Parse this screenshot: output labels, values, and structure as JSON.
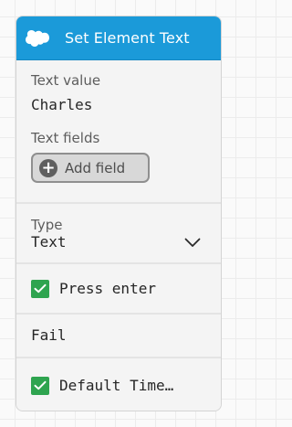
{
  "node": {
    "title": "Set Element Text",
    "logo_icon": "salesforce-cloud-icon",
    "accent_color": "#1b9ad9"
  },
  "text_value": {
    "label": "Text value",
    "value": "Charles"
  },
  "text_fields": {
    "label": "Text fields",
    "add_button_label": "Add field",
    "add_icon": "plus-circle-icon"
  },
  "type": {
    "label": "Type",
    "selected": "Text",
    "dropdown_icon": "chevron-down-icon"
  },
  "press_enter": {
    "label": "Press enter",
    "checked": true,
    "check_color": "#2ea44f"
  },
  "fail": {
    "label": "Fail"
  },
  "default_timeout": {
    "label": "Default Time…",
    "checked": true
  }
}
